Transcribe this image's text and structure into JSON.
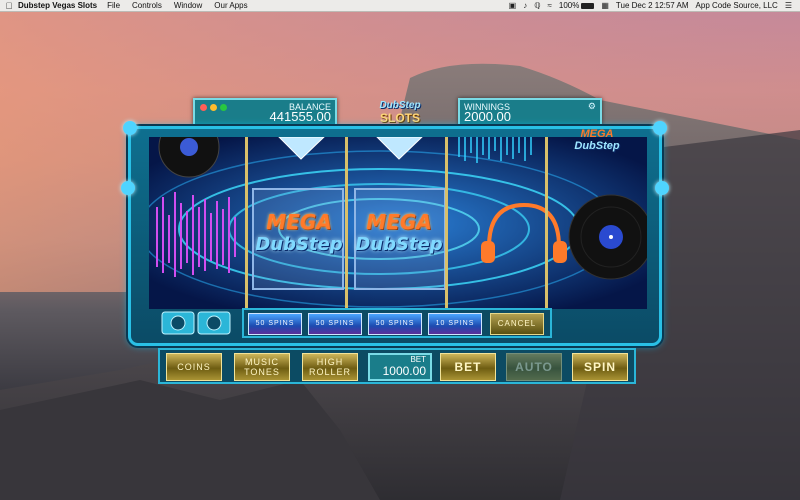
{
  "menubar": {
    "app_name": "Dubstep Vegas Slots",
    "menus": [
      "File",
      "Controls",
      "Window",
      "Our Apps"
    ],
    "battery": "100%",
    "datetime": "Tue Dec 2  12:57 AM",
    "user": "App Code Source, LLC"
  },
  "balance": {
    "label": "BALANCE",
    "value": "441555.00"
  },
  "winnings": {
    "label": "WINNINGS",
    "value": "2000.00"
  },
  "logo": {
    "line1": "DubStep",
    "line2": "SLOTS"
  },
  "brand": {
    "line1": "MEGA",
    "line2": "DubStep"
  },
  "reels": {
    "mega_word": "MEGA",
    "dub_word": "DubStep"
  },
  "spin_options": [
    "50 SPINS",
    "50 SPINS",
    "50 SPINS",
    "10 SPINS"
  ],
  "cancel_label": "CANCEL",
  "controls": {
    "coins": "COINS",
    "music_tones_1": "MUSIC",
    "music_tones_2": "TONES",
    "high_roller_1": "HIGH",
    "high_roller_2": "ROLLER",
    "bet_label": "BET",
    "bet_value": "1000.00",
    "bet_button": "BET",
    "auto_button": "AUTO",
    "spin_button": "SPIN"
  },
  "colors": {
    "panel": "#1a7d8a",
    "frame": "#29c0e6",
    "gold": "#cdb55a",
    "reel_bg": "#071a52"
  }
}
